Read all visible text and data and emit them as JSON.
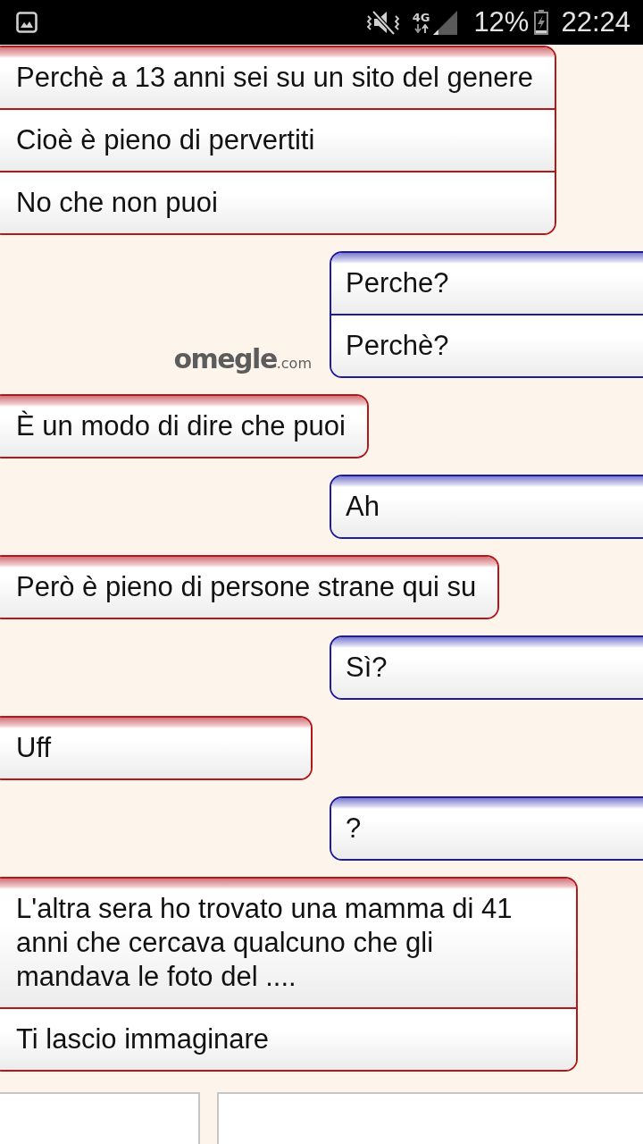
{
  "status_bar": {
    "network": "4G",
    "battery": "12%",
    "time": "22:24"
  },
  "messages": [
    {
      "kind": "stranger",
      "lines": [
        "Perchè a 13 anni sei su un sito del genere",
        "Cioè è pieno di pervertiti",
        "No che non puoi"
      ]
    },
    {
      "kind": "you",
      "logo": {
        "name": "omegle",
        "domain": ".com"
      },
      "lines": [
        "Perche?",
        "Perchè?"
      ]
    },
    {
      "kind": "stranger",
      "lines": [
        "È un modo di dire che puoi"
      ]
    },
    {
      "kind": "you",
      "lines": [
        "Ah"
      ]
    },
    {
      "kind": "stranger",
      "lines": [
        "Però è pieno di persone strane qui su"
      ]
    },
    {
      "kind": "you",
      "lines": [
        "Sì?"
      ]
    },
    {
      "kind": "stranger",
      "lines": [
        "Uff"
      ]
    },
    {
      "kind": "you",
      "lines": [
        "?"
      ]
    },
    {
      "kind": "stranger",
      "lines": [
        "L'altra sera ho trovato una mamma di 41 anni che cercava qualcuno che gli mandava le foto del ....",
        "Ti lascio immaginare"
      ]
    }
  ]
}
